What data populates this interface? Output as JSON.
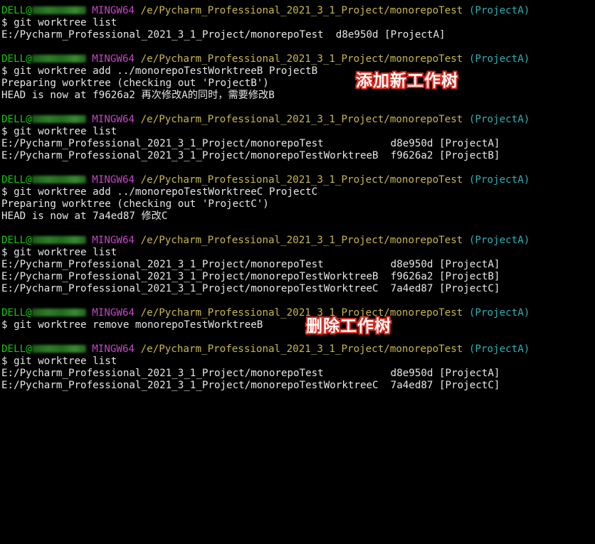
{
  "prompt": {
    "user": "DELL@",
    "host": "MINGW64",
    "path": "/e/Pycharm_Professional_2021_3_1_Project/monorepoTest",
    "branch": "(ProjectA)"
  },
  "blocks": [
    {
      "command": "$ git worktree list",
      "output": [
        "E:/Pycharm_Professional_2021_3_1_Project/monorepoTest  d8e950d [ProjectA]"
      ]
    },
    {
      "command": "$ git worktree add ../monorepoTestWorktreeB ProjectB",
      "output": [
        "Preparing worktree (checking out 'ProjectB')",
        "HEAD is now at f9626a2 再次修改A的同时，需要修改B"
      ]
    },
    {
      "command": "$ git worktree list",
      "output": [
        "E:/Pycharm_Professional_2021_3_1_Project/monorepoTest           d8e950d [ProjectA]",
        "E:/Pycharm_Professional_2021_3_1_Project/monorepoTestWorktreeB  f9626a2 [ProjectB]"
      ]
    },
    {
      "command": "$ git worktree add ../monorepoTestWorktreeC ProjectC",
      "output": [
        "Preparing worktree (checking out 'ProjectC')",
        "HEAD is now at 7a4ed87 修改C"
      ]
    },
    {
      "command": "$ git worktree list",
      "output": [
        "E:/Pycharm_Professional_2021_3_1_Project/monorepoTest           d8e950d [ProjectA]",
        "E:/Pycharm_Professional_2021_3_1_Project/monorepoTestWorktreeB  f9626a2 [ProjectB]",
        "E:/Pycharm_Professional_2021_3_1_Project/monorepoTestWorktreeC  7a4ed87 [ProjectC]"
      ]
    },
    {
      "command": "$ git worktree remove monorepoTestWorktreeB",
      "output": []
    },
    {
      "command": "$ git worktree list",
      "output": [
        "E:/Pycharm_Professional_2021_3_1_Project/monorepoTest           d8e950d [ProjectA]",
        "E:/Pycharm_Professional_2021_3_1_Project/monorepoTestWorktreeC  7a4ed87 [ProjectC]"
      ]
    }
  ],
  "annotations": {
    "add_worktree": "添加新工作树",
    "remove_worktree": "删除工作树"
  },
  "colors": {
    "background": "#000000",
    "user": "#16c60c",
    "host": "#c545c8",
    "path": "#c8b74a",
    "branch": "#2ab1b5",
    "text": "#e6e6e6",
    "annotation_outline": "#d8281e"
  }
}
